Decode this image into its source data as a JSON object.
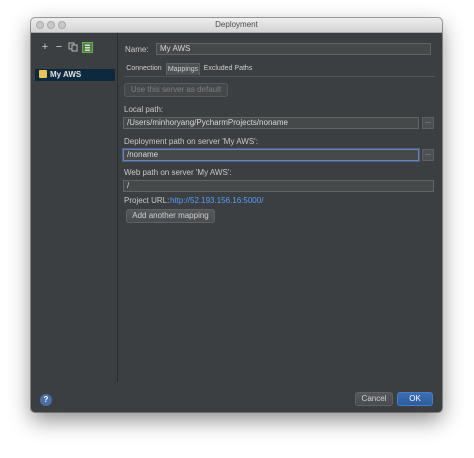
{
  "window": {
    "title": "Deployment"
  },
  "toolbar": {
    "add": "+",
    "remove": "−"
  },
  "sidebar": {
    "items": [
      {
        "label": "My AWS"
      }
    ]
  },
  "server": {
    "name_label": "Name:",
    "name_value": "My AWS"
  },
  "tabs": [
    {
      "label": "Connection"
    },
    {
      "label": "Mappings"
    },
    {
      "label": "Excluded Paths"
    }
  ],
  "mappings": {
    "use_default_label": "Use this server as default",
    "local_path_label": "Local path:",
    "local_path_value": "/Users/minhoryang/PycharmProjects/noname",
    "deploy_path_label": "Deployment path on server 'My AWS':",
    "deploy_path_value": "/noname",
    "web_path_label": "Web path on server 'My AWS':",
    "web_path_value": "/",
    "project_url_label": "Project URL:",
    "project_url_value": "http://52.193.156.16:5000/",
    "add_mapping_label": "Add another mapping",
    "browse": "..."
  },
  "footer": {
    "help": "?",
    "cancel_label": "Cancel",
    "ok_label": "OK"
  }
}
